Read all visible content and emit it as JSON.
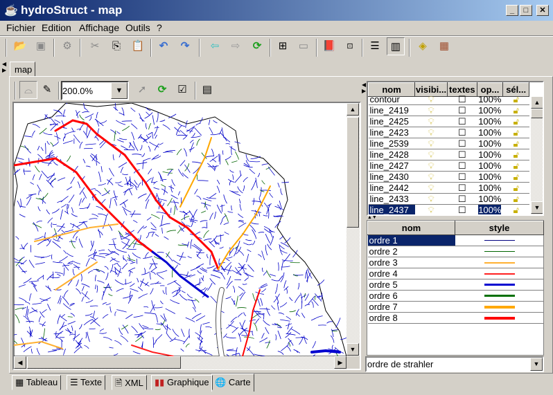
{
  "window": {
    "title": "hydroStruct - map",
    "minimize": "_",
    "maximize": "□",
    "close": "✕"
  },
  "menu": [
    "Fichier",
    "Edition",
    "Affichage",
    "Outils",
    "?"
  ],
  "toolbar": [
    "open-folder",
    "save",
    "tap",
    "cut",
    "copy",
    "paste",
    "undo",
    "redo",
    "back",
    "forward",
    "refresh",
    "add-layer",
    "remove-layer",
    "book",
    "structure",
    "list",
    "columns",
    "warning",
    "database"
  ],
  "doc_tab": "map",
  "map_toolbar": {
    "zoom_value": "200.0%"
  },
  "layers": {
    "columns": [
      "nom",
      "visibi...",
      "textes",
      "op...",
      "sél..."
    ],
    "rows": [
      {
        "nom": "contour",
        "opacity": "100%"
      },
      {
        "nom": "line_2419",
        "opacity": "100%"
      },
      {
        "nom": "line_2425",
        "opacity": "100%"
      },
      {
        "nom": "line_2423",
        "opacity": "100%"
      },
      {
        "nom": "line_2539",
        "opacity": "100%"
      },
      {
        "nom": "line_2428",
        "opacity": "100%"
      },
      {
        "nom": "line_2427",
        "opacity": "100%"
      },
      {
        "nom": "line_2430",
        "opacity": "100%"
      },
      {
        "nom": "line_2442",
        "opacity": "100%"
      },
      {
        "nom": "line_2433",
        "opacity": "100%"
      },
      {
        "nom": "line_2437",
        "opacity": "100%"
      }
    ],
    "selected": "line_2437"
  },
  "legend": {
    "columns": [
      "nom",
      "style"
    ],
    "rows": [
      {
        "nom": "ordre 1",
        "color": "#000080",
        "width": 1
      },
      {
        "nom": "ordre 2",
        "color": "#006400",
        "width": 1
      },
      {
        "nom": "ordre 3",
        "color": "#ffb030",
        "width": 2
      },
      {
        "nom": "ordre 4",
        "color": "#ff2020",
        "width": 2
      },
      {
        "nom": "ordre 5",
        "color": "#0000d0",
        "width": 3
      },
      {
        "nom": "ordre 6",
        "color": "#007000",
        "width": 3
      },
      {
        "nom": "ordre 7",
        "color": "#ffa800",
        "width": 4
      },
      {
        "nom": "ordre 8",
        "color": "#ff0000",
        "width": 4
      }
    ],
    "selected": "ordre 1"
  },
  "classification": "ordre de strahler",
  "bottom_tabs": [
    "Tableau",
    "Texte",
    "XML",
    "Graphique",
    "Carte"
  ],
  "active_bottom_tab": "Carte"
}
